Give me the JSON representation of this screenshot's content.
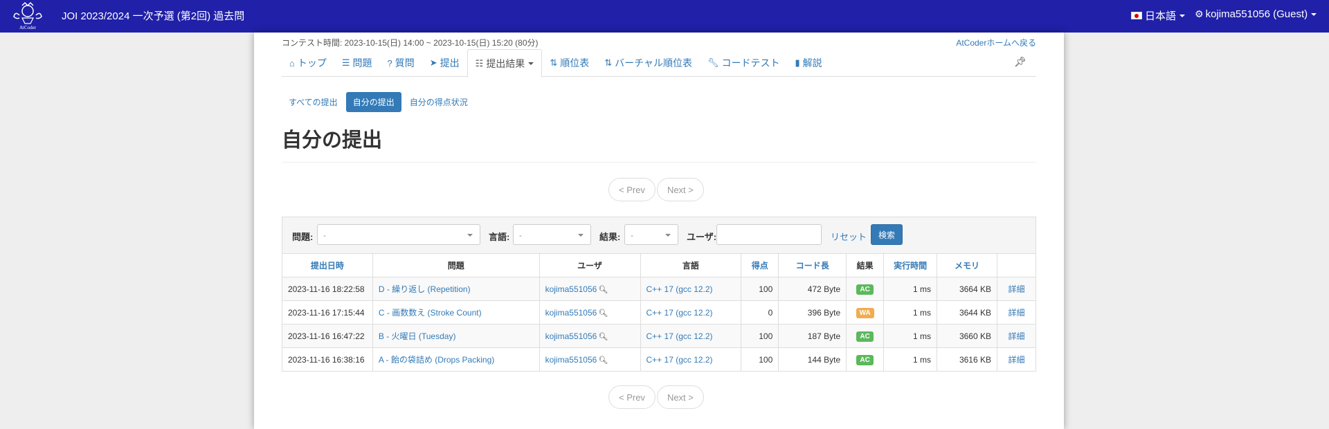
{
  "navbar": {
    "logo_text": "AtCoder",
    "contest_title": "JOI 2023/2024 一次予選 (第2回) 過去問",
    "language": "日本語",
    "user": "kojima551056 (Guest)"
  },
  "header": {
    "contest_time": "コンテスト時間: 2023-10-15(日) 14:00 ~ 2023-10-15(日) 15:20 (80分)",
    "back_home": "AtCoderホームへ戻る"
  },
  "tabs": [
    {
      "label": "トップ",
      "icon": "home-icon"
    },
    {
      "label": "問題",
      "icon": "tasks-icon"
    },
    {
      "label": "質問",
      "icon": "question-icon"
    },
    {
      "label": "提出",
      "icon": "send-icon"
    },
    {
      "label": "提出結果",
      "icon": "list-icon",
      "active": true
    },
    {
      "label": "順位表",
      "icon": "sort-icon"
    },
    {
      "label": "バーチャル順位表",
      "icon": "sort-icon"
    },
    {
      "label": "コードテスト",
      "icon": "wrench-icon"
    },
    {
      "label": "解説",
      "icon": "book-icon"
    }
  ],
  "subnav": {
    "all": "すべての提出",
    "mine": "自分の提出",
    "score": "自分の得点状況"
  },
  "page_title": "自分の提出",
  "pager": {
    "prev": "< Prev",
    "next": "Next >"
  },
  "filter": {
    "task_label": "問題:",
    "task_value": "-",
    "lang_label": "言語:",
    "lang_value": "-",
    "status_label": "結果:",
    "status_value": "-",
    "user_label": "ユーザ:",
    "user_value": "",
    "reset": "リセット",
    "search": "検索"
  },
  "table": {
    "headers": [
      "提出日時",
      "問題",
      "ユーザ",
      "言語",
      "得点",
      "コード長",
      "結果",
      "実行時間",
      "メモリ",
      ""
    ],
    "rows": [
      {
        "time": "2023-11-16 18:22:58",
        "task": "D - 繰り返し (Repetition)",
        "user": "kojima551056",
        "lang": "C++ 17 (gcc 12.2)",
        "score": "100",
        "code": "472 Byte",
        "status": "AC",
        "exec": "1 ms",
        "mem": "3664 KB",
        "detail": "詳細"
      },
      {
        "time": "2023-11-16 17:15:44",
        "task": "C - 画数数え (Stroke Count)",
        "user": "kojima551056",
        "lang": "C++ 17 (gcc 12.2)",
        "score": "0",
        "code": "396 Byte",
        "status": "WA",
        "exec": "1 ms",
        "mem": "3644 KB",
        "detail": "詳細"
      },
      {
        "time": "2023-11-16 16:47:22",
        "task": "B - 火曜日 (Tuesday)",
        "user": "kojima551056",
        "lang": "C++ 17 (gcc 12.2)",
        "score": "100",
        "code": "187 Byte",
        "status": "AC",
        "exec": "1 ms",
        "mem": "3660 KB",
        "detail": "詳細"
      },
      {
        "time": "2023-11-16 16:38:16",
        "task": "A - 飴の袋詰め (Drops Packing)",
        "user": "kojima551056",
        "lang": "C++ 17 (gcc 12.2)",
        "score": "100",
        "code": "144 Byte",
        "status": "AC",
        "exec": "1 ms",
        "mem": "3616 KB",
        "detail": "詳細"
      }
    ]
  },
  "colors": {
    "navbar": "#2020a8",
    "link": "#337ab7",
    "ac": "#5cb85c",
    "wa": "#f0ad4e"
  }
}
